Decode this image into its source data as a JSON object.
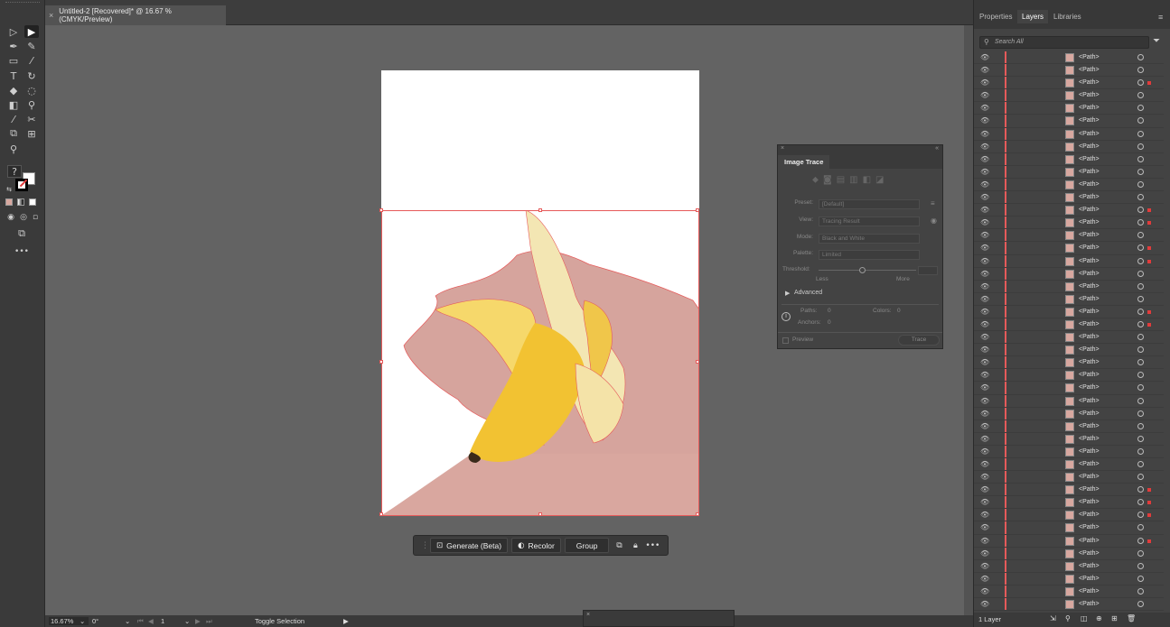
{
  "doc_tab": {
    "title": "Untitled-2 [Recovered]* @ 16.67 % (CMYK/Preview)",
    "close": "×"
  },
  "taskbar": {
    "generate": "Generate (Beta)",
    "recolor": "Recolor",
    "group": "Group",
    "more": "•••"
  },
  "image_trace": {
    "title": "Image Trace",
    "preset_label": "Preset:",
    "preset_value": "[Default]",
    "view_label": "View:",
    "view_value": "Tracing Result",
    "mode_label": "Mode:",
    "mode_value": "Black and White",
    "palette_label": "Palette:",
    "palette_value": "Limited",
    "threshold_label": "Threshold:",
    "less": "Less",
    "more": "More",
    "advanced": "Advanced",
    "paths_label": "Paths:",
    "paths_value": "0",
    "colors_label": "Colors:",
    "colors_value": "0",
    "anchors_label": "Anchors:",
    "anchors_value": "0",
    "preview": "Preview",
    "trace_button": "Trace"
  },
  "status": {
    "zoom": "16.67%",
    "rotate": "0°",
    "artboard": "1",
    "toggle": "Toggle Selection"
  },
  "right_panel": {
    "tabs": [
      "Properties",
      "Layers",
      "Libraries"
    ],
    "search_placeholder": "Search All",
    "footer": "1 Layer",
    "rows": [
      {
        "name": "<Path>",
        "flag": false
      },
      {
        "name": "<Path>",
        "flag": false
      },
      {
        "name": "<Path>",
        "flag": true
      },
      {
        "name": "<Path>",
        "flag": false
      },
      {
        "name": "<Path>",
        "flag": false
      },
      {
        "name": "<Path>",
        "flag": false
      },
      {
        "name": "<Path>",
        "flag": false
      },
      {
        "name": "<Path>",
        "flag": false
      },
      {
        "name": "<Path>",
        "flag": false
      },
      {
        "name": "<Path>",
        "flag": false
      },
      {
        "name": "<Path>",
        "flag": false
      },
      {
        "name": "<Path>",
        "flag": false
      },
      {
        "name": "<Path>",
        "flag": true
      },
      {
        "name": "<Path>",
        "flag": true
      },
      {
        "name": "<Path>",
        "flag": false
      },
      {
        "name": "<Path>",
        "flag": true
      },
      {
        "name": "<Path>",
        "flag": true
      },
      {
        "name": "<Path>",
        "flag": false
      },
      {
        "name": "<Path>",
        "flag": false
      },
      {
        "name": "<Path>",
        "flag": false
      },
      {
        "name": "<Path>",
        "flag": true
      },
      {
        "name": "<Path>",
        "flag": true
      },
      {
        "name": "<Path>",
        "flag": false
      },
      {
        "name": "<Path>",
        "flag": false
      },
      {
        "name": "<Path>",
        "flag": false
      },
      {
        "name": "<Path>",
        "flag": false
      },
      {
        "name": "<Path>",
        "flag": false
      },
      {
        "name": "<Path>",
        "flag": false
      },
      {
        "name": "<Path>",
        "flag": false
      },
      {
        "name": "<Path>",
        "flag": false
      },
      {
        "name": "<Path>",
        "flag": false
      },
      {
        "name": "<Path>",
        "flag": false
      },
      {
        "name": "<Path>",
        "flag": false
      },
      {
        "name": "<Path>",
        "flag": false
      },
      {
        "name": "<Path>",
        "flag": true
      },
      {
        "name": "<Path>",
        "flag": true
      },
      {
        "name": "<Path>",
        "flag": true
      },
      {
        "name": "<Path>",
        "flag": false
      },
      {
        "name": "<Path>",
        "flag": true
      },
      {
        "name": "<Path>",
        "flag": false
      },
      {
        "name": "<Path>",
        "flag": false
      },
      {
        "name": "<Path>",
        "flag": false
      },
      {
        "name": "<Path>",
        "flag": false
      },
      {
        "name": "<Path>",
        "flag": false
      }
    ]
  },
  "colors": {
    "accent": "#e65a5a",
    "artboard_pink": "#d6a49d",
    "banana_yellow": "#f2c232"
  }
}
